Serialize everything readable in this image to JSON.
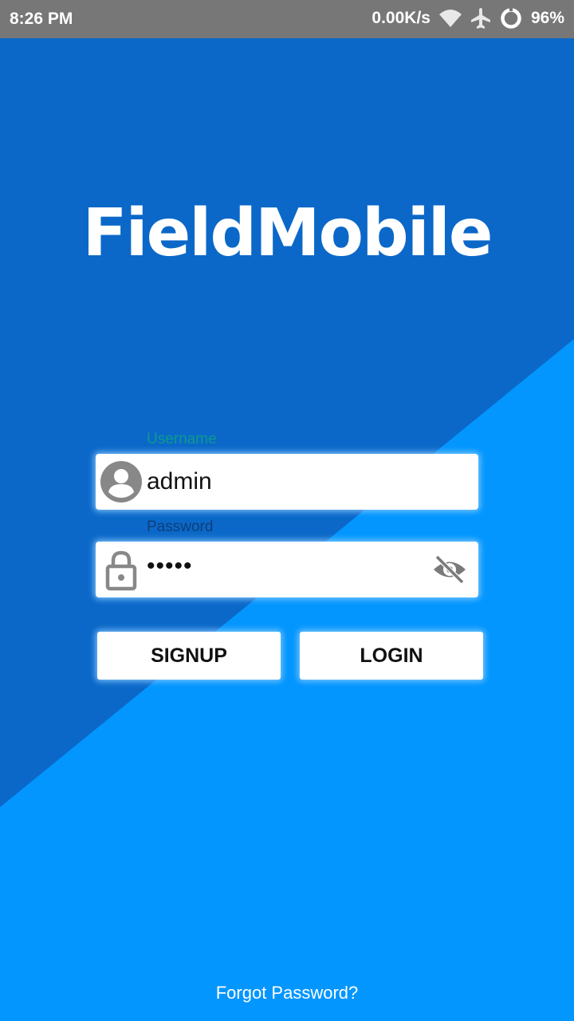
{
  "status_bar": {
    "time": "8:26 PM",
    "network_speed": "0.00K/s",
    "battery": "96%",
    "icons": [
      "wifi-icon",
      "airplane-icon",
      "battery-ring-icon"
    ]
  },
  "app": {
    "logo_text": "FieldMobile"
  },
  "login_form": {
    "username_label": "Username",
    "username_value": "admin",
    "password_label": "Password",
    "password_value": "•••••",
    "signup_label": "SIGNUP",
    "login_label": "LOGIN",
    "forgot_label": "Forgot Password?"
  },
  "colors": {
    "background_light": "#0396fe",
    "background_dark": "#0b68c8",
    "status_bar": "#777777",
    "username_label": "#0c9a8e",
    "password_label": "#0d3f7a",
    "icon_gray": "#888888"
  }
}
